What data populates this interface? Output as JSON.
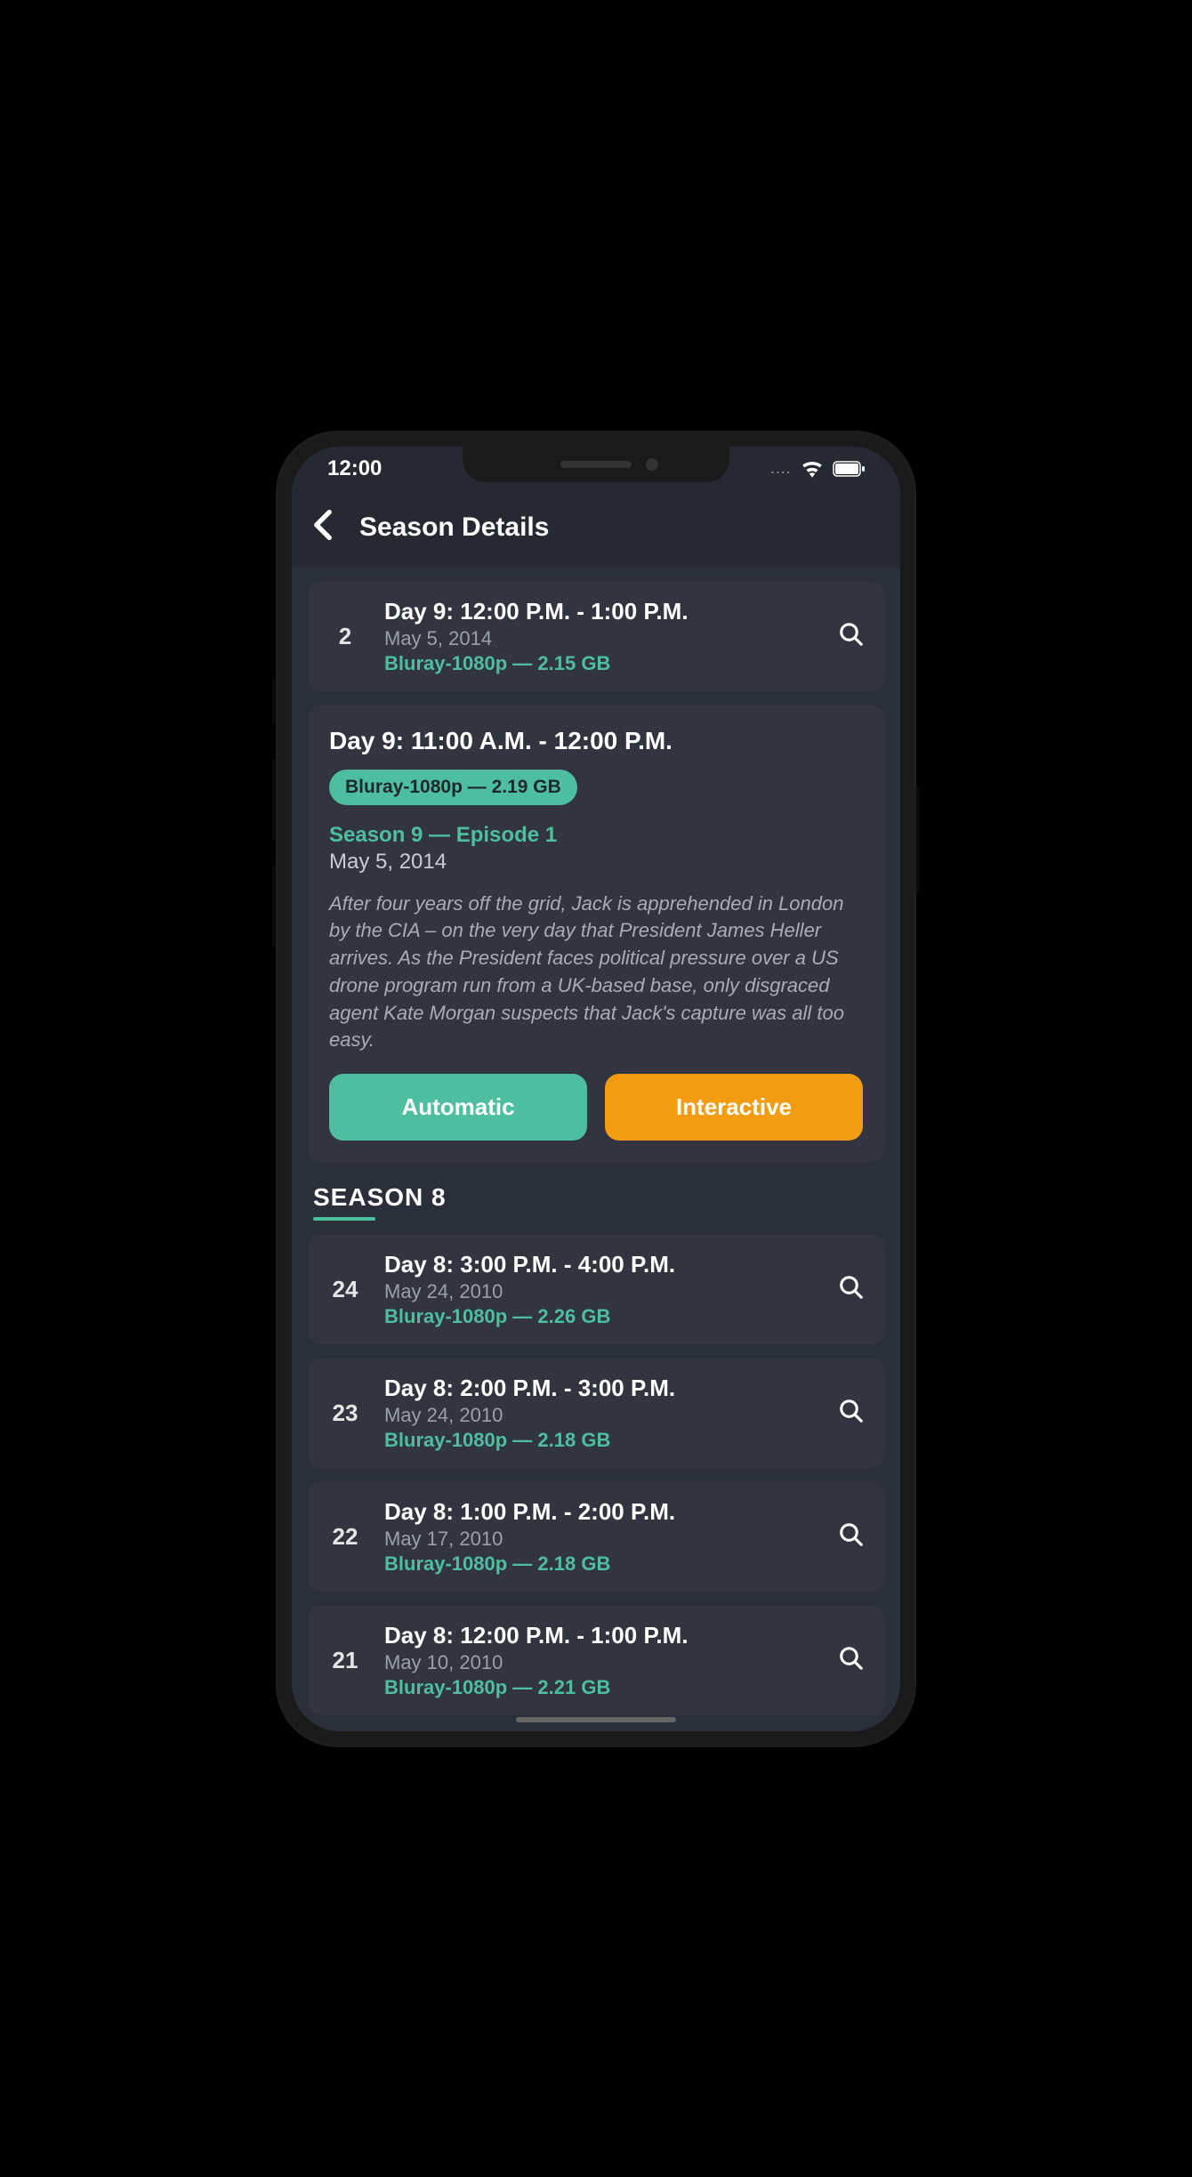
{
  "status": {
    "time": "12:00",
    "dots": "...."
  },
  "header": {
    "title": "Season Details"
  },
  "episodes_top": [
    {
      "number": "2",
      "title": "Day 9: 12:00 P.M. - 1:00 P.M.",
      "date": "May 5, 2014",
      "quality": "Bluray-1080p — 2.15 GB"
    }
  ],
  "expanded": {
    "title": "Day 9: 11:00 A.M. - 12:00 P.M.",
    "quality_badge": "Bluray-1080p — 2.19 GB",
    "season_line": "Season 9 — Episode 1",
    "date": "May 5, 2014",
    "description": "After four years off the grid, Jack is apprehended in London by the CIA – on the very day that President James Heller arrives. As the President faces political pressure over a US drone program run from a UK-based base, only disgraced agent Kate Morgan suspects that Jack's capture was all too easy.",
    "btn_auto": "Automatic",
    "btn_interactive": "Interactive"
  },
  "season8": {
    "label": "SEASON 8",
    "episodes": [
      {
        "number": "24",
        "title": "Day 8: 3:00 P.M. - 4:00 P.M.",
        "date": "May 24, 2010",
        "quality": "Bluray-1080p — 2.26 GB"
      },
      {
        "number": "23",
        "title": "Day 8: 2:00 P.M. - 3:00 P.M.",
        "date": "May 24, 2010",
        "quality": "Bluray-1080p — 2.18 GB"
      },
      {
        "number": "22",
        "title": "Day 8: 1:00 P.M. - 2:00 P.M.",
        "date": "May 17, 2010",
        "quality": "Bluray-1080p — 2.18 GB"
      },
      {
        "number": "21",
        "title": "Day 8: 12:00 P.M. - 1:00 P.M.",
        "date": "May 10, 2010",
        "quality": "Bluray-1080p — 2.21 GB"
      }
    ]
  }
}
